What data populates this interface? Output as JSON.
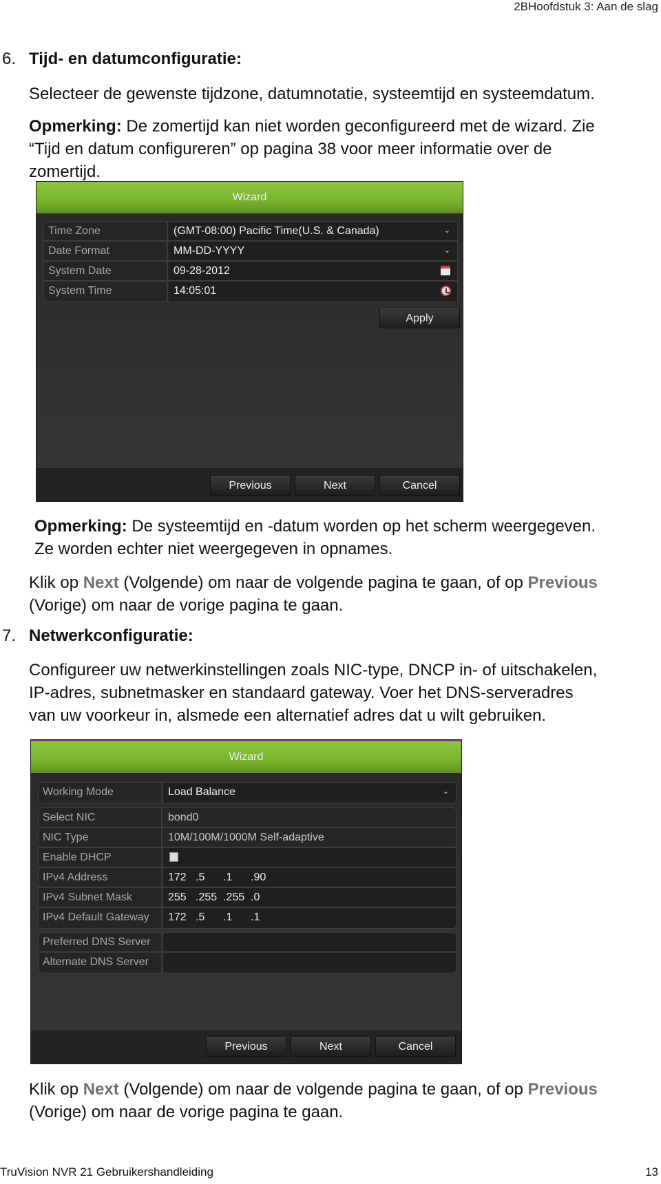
{
  "page": {
    "running_header": "2BHoofdstuk 3: Aan de slag",
    "footer_title": "TruVision NVR 21 Gebruikershandleiding",
    "page_number": "13"
  },
  "step6": {
    "number": "6.",
    "heading": "Tijd- en datumconfiguratie:",
    "intro": "Selecteer de gewenste tijdzone, datumnotatie, systeemtijd en systeemdatum.",
    "note_label": "Opmerking:",
    "note_line1": " De zomertijd kan niet worden geconfigureerd met de wizard. Zie",
    "note_line2": "“Tijd en datum configureren” op pagina 38 voor meer informatie over de",
    "note_line3": "zomertijd.",
    "wizard": {
      "title": "Wizard",
      "rows": [
        {
          "label": "Time Zone",
          "value": "(GMT-08:00) Pacific Time(U.S. & Canada)",
          "control": "dropdown"
        },
        {
          "label": "Date Format",
          "value": "MM-DD-YYYY",
          "control": "dropdown"
        },
        {
          "label": "System Date",
          "value": "09-28-2012",
          "control": "calendar-icon"
        },
        {
          "label": "System Time",
          "value": "14:05:01",
          "control": "clock-icon"
        }
      ],
      "apply_label": "Apply",
      "previous_label": "Previous",
      "next_label": "Next",
      "cancel_label": "Cancel"
    },
    "note2_label": "Opmerking:",
    "note2_line1": " De systeemtijd en -datum worden op het scherm weergegeven.",
    "note2_line2": "Ze worden echter niet weergegeven in opnames.",
    "nav_text": {
      "pre": "Klik op ",
      "next": "Next",
      "mid": " (Volgende) om naar de volgende pagina te gaan, of op ",
      "previous": "Previous",
      "post": "(Vorige) om naar de vorige pagina te gaan."
    }
  },
  "step7": {
    "number": "7.",
    "heading": "Netwerkconfiguratie:",
    "intro_line1": "Configureer uw netwerkinstellingen zoals NIC-type, DNCP in- of uitschakelen,",
    "intro_line2": "IP-adres, subnetmasker en standaard gateway. Voer het DNS-serveradres",
    "intro_line3": "van uw voorkeur in, alsmede een alternatief adres dat u wilt gebruiken.",
    "wizard": {
      "title": "Wizard",
      "working_mode": {
        "label": "Working Mode",
        "value": "Load Balance"
      },
      "select_nic": {
        "label": "Select NIC",
        "value": "bond0"
      },
      "nic_type": {
        "label": "NIC Type",
        "value": "10M/100M/1000M Self-adaptive"
      },
      "enable_dhcp": {
        "label": "Enable DHCP",
        "checked": false
      },
      "ipv4_address": {
        "label": "IPv4 Address",
        "octets": [
          "172",
          ".5",
          ".1",
          ".90"
        ]
      },
      "ipv4_subnet": {
        "label": "IPv4 Subnet Mask",
        "octets": [
          "255",
          ".255",
          ".255",
          ".0"
        ]
      },
      "ipv4_gateway": {
        "label": "IPv4 Default Gateway",
        "octets": [
          "172",
          ".5",
          ".1",
          ".1"
        ]
      },
      "preferred_dns": {
        "label": "Preferred DNS Server",
        "value": ""
      },
      "alternate_dns": {
        "label": "Alternate DNS Server",
        "value": ""
      },
      "previous_label": "Previous",
      "next_label": "Next",
      "cancel_label": "Cancel"
    },
    "nav_text": {
      "pre": "Klik op ",
      "next": "Next",
      "mid": " (Volgende) om naar de volgende pagina te gaan, of op ",
      "previous": "Previous",
      "post": "(Vorige) om naar de vorige pagina te gaan."
    }
  },
  "colors": {
    "wizard_header_green": "#79b42f",
    "wizard_body": "#303030",
    "link_gray": "#707070"
  }
}
